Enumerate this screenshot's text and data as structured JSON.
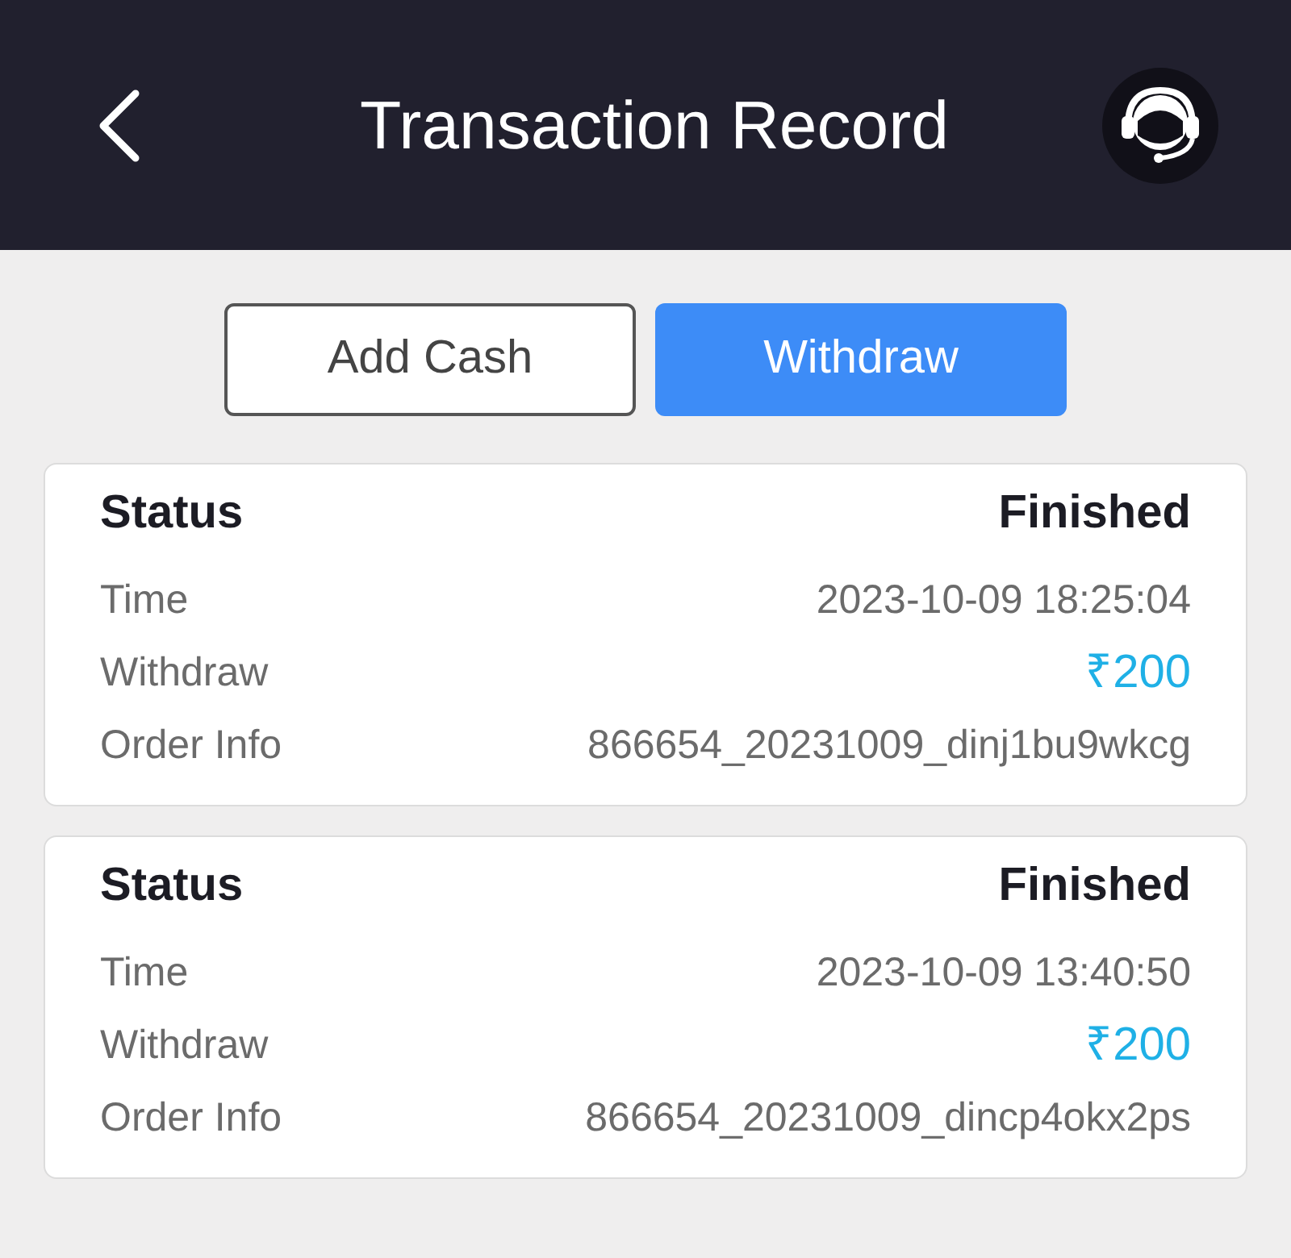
{
  "header": {
    "title": "Transaction Record"
  },
  "tabs": [
    {
      "label": "Add Cash",
      "selected": false
    },
    {
      "label": "Withdraw",
      "selected": true
    }
  ],
  "records": [
    {
      "rows": [
        {
          "kind": "status",
          "label": "Status",
          "value": "Finished"
        },
        {
          "kind": "plain",
          "label": "Time",
          "value": "2023-10-09 18:25:04"
        },
        {
          "kind": "amount",
          "label": "Withdraw",
          "value": "₹200"
        },
        {
          "kind": "plain",
          "label": "Order Info",
          "value": "866654_20231009_dinj1bu9wkcg"
        }
      ]
    },
    {
      "rows": [
        {
          "kind": "status",
          "label": "Status",
          "value": "Finished"
        },
        {
          "kind": "plain",
          "label": "Time",
          "value": "2023-10-09 13:40:50"
        },
        {
          "kind": "amount",
          "label": "Withdraw",
          "value": "₹200"
        },
        {
          "kind": "plain",
          "label": "Order Info",
          "value": "866654_20231009_dincp4okx2ps"
        }
      ]
    }
  ]
}
